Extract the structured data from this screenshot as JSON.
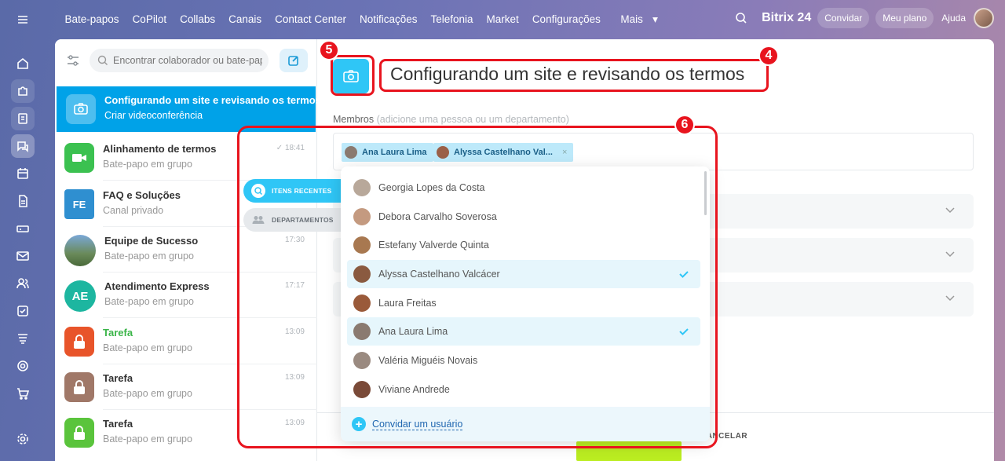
{
  "nav": {
    "links": [
      "Bate-papos",
      "CoPilot",
      "Collabs",
      "Canais",
      "Contact Center",
      "Notificações",
      "Telefonia",
      "Market",
      "Configurações",
      "Mais"
    ],
    "brand": "Bitrix",
    "brand_num": "24",
    "invite": "Convidar",
    "plan": "Meu plano",
    "help": "Ajuda"
  },
  "sidebar": {
    "search_placeholder": "Encontrar colaborador ou bate-papo"
  },
  "chats": [
    {
      "title": "Configurando um site e revisando os termos",
      "subtitle": "Criar videoconferência",
      "time": ""
    },
    {
      "title": "Alinhamento de termos",
      "subtitle": "Bate-papo em grupo",
      "time": "18:41"
    },
    {
      "title": "FAQ e Soluções",
      "subtitle": "Canal privado",
      "time": "",
      "initials": "FE"
    },
    {
      "title": "Equipe de Sucesso",
      "subtitle": "Bate-papo em grupo",
      "time": "17:30"
    },
    {
      "title": "Atendimento Express",
      "subtitle": "Bate-papo em grupo",
      "time": "17:17",
      "initials": "AE"
    },
    {
      "title": "Tarefa",
      "subtitle": "Bate-papo em grupo",
      "time": "13:09"
    },
    {
      "title": "Tarefa",
      "subtitle": "Bate-papo em grupo",
      "time": "13:09"
    },
    {
      "title": "Tarefa",
      "subtitle": "Bate-papo em grupo",
      "time": "13:09"
    }
  ],
  "tabs": {
    "recent": "ITENS RECENTES",
    "departments": "DEPARTAMENTOS"
  },
  "editor": {
    "title": "Configurando um site e revisando os termos",
    "members_label": "Membros",
    "members_hint": "(adicione uma pessoa ou um departamento)",
    "selected": [
      "Ana Laura Lima",
      "Alyssa Castelhano Val..."
    ],
    "cancel": "CANCELAR"
  },
  "dropdown": {
    "people": [
      {
        "name": "Georgia Lopes da Costa",
        "checked": false
      },
      {
        "name": "Debora Carvalho Soverosa",
        "checked": false
      },
      {
        "name": "Estefany Valverde Quinta",
        "checked": false
      },
      {
        "name": "Alyssa Castelhano Valcácer",
        "checked": true
      },
      {
        "name": "Laura Freitas",
        "checked": false
      },
      {
        "name": "Ana Laura Lima",
        "checked": true
      },
      {
        "name": "Valéria Miguéis Novais",
        "checked": false
      },
      {
        "name": "Viviane Andrede",
        "checked": false
      }
    ],
    "invite": "Convidar um usuário"
  },
  "annotations": [
    "4",
    "5",
    "6"
  ],
  "colors": {
    "accent": "#2fc6f6",
    "selected_chat": "#00a2e8",
    "annotation": "#e8141e",
    "green": "#bbed21"
  }
}
